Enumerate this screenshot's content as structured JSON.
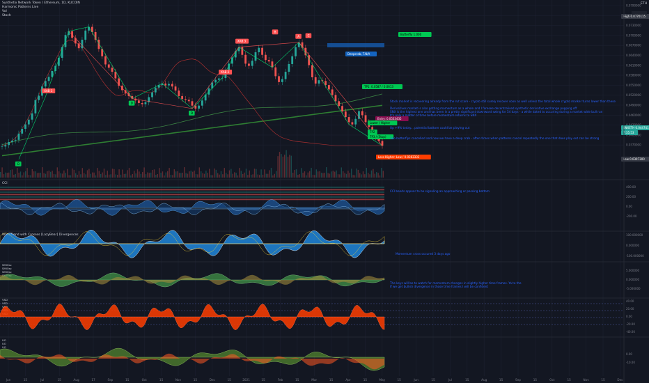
{
  "header": {
    "title": "Synthetix Network Token / Ethereum, 1D, KUCOIN",
    "line2": "Harmonic Patterns  Live",
    "line3": "Vol",
    "line4": "Stoch",
    "currency": "ETH"
  },
  "notes": [
    "Stock market is recovering already from the rut scare - crypto still surely recover soon as well unless the total whole crypto marker turns lower than these",
    "Derivatives market is also getting momentum as a whole and I foresee decentralised synthetic derivative exchange popping off",
    "SNX is the highest one and has been in a pretty significant downward swing for 54 days - a while dated to accuring during a market wide bull run",
    "It's only a matter of time before momentum returns to SNX",
    "Up +9% today... potential bottom could be playing out",
    "Two butterflys cancelled and now we have a deep crab - often times when patterns cancel repeatedly the one that does play out can be strong",
    "CCI bands appear to be signaling an approaching or passing bottom",
    "Momentum cross occured 3 days ago",
    "The keys will be to watch for momentum changes in slightly higher time frames. Ya to the",
    "If we get bullish divergence in those time frames I will be confident"
  ],
  "price_axis": [
    "0.0790000",
    "0.0760000",
    "0.0730000",
    "0.0700000",
    "0.0670000",
    "0.0640000",
    "0.0610000",
    "0.0580000",
    "0.0550000",
    "0.0520000",
    "0.0490000",
    "0.0460000",
    "0.0430000",
    "0.0400000",
    "0.0370000"
  ],
  "price_tags": {
    "high": "High",
    "high_val": "0.0770115",
    "last_sym": "SNXETH",
    "last_val": "0.0447411",
    "timer": "7:35:53",
    "low": "Low",
    "low_val": "0.0397300"
  },
  "pane_labels": {
    "cci": "CCI",
    "wave": "WaveTrend with Crosses [LazyBear]  Divergences",
    "smi": [
      "SMIOsc",
      "SMIOsc",
      "SMIOsc",
      "SMIOsc"
    ],
    "vsd": [
      "VSD",
      "VSD",
      "VSD",
      "VSD",
      "VSD"
    ],
    "uo": [
      "UO",
      "UO",
      "UO"
    ]
  },
  "pane_axes": {
    "cci": [
      "400.00",
      "200.00",
      "0.00",
      "-200.00"
    ],
    "wave": [
      "100.000000",
      "0.000000",
      "-100.000000"
    ],
    "smi": [
      "5.000000",
      "0.000000",
      "-5.000000"
    ],
    "vsd": [
      "40.00",
      "20.00",
      "0.00",
      "-20.00",
      "-40.00"
    ],
    "uo": [
      "0.00",
      "-10.00"
    ]
  },
  "time_labels": [
    "Jun",
    "15",
    "Jul",
    "15",
    "Aug",
    "17",
    "Sep",
    "15",
    "Oct",
    "15",
    "Nov",
    "15",
    "Dec",
    "15",
    "2021",
    "15",
    "Feb",
    "15",
    "Mar",
    "15",
    "Apr",
    "15",
    "May",
    "15",
    "Jun",
    "15",
    "Jul",
    "15",
    "Aug",
    "15",
    "Sep",
    "15",
    "Oct",
    "15",
    "Nov",
    "15",
    "Dec"
  ],
  "pattern_labels": {
    "x1": "XAB 1",
    "x2": "XAB 2",
    "x3": "XAB 3",
    "a": "A",
    "b": "B",
    "c": "C",
    "d1": "D",
    "d2": "D",
    "d3": "D",
    "zoom": "Butterfly  1.000",
    "target": "TP1: 0.0587 / 0.0613",
    "entry": "Entry: 0.0533435",
    "box": "Deepcrab, T.N/A",
    "loss": "Loss Higher: Low / 0.0363333",
    "green1": "Lower / Higher",
    "green2": "TP2",
    "green3": "TP3 / (Stop)"
  },
  "colors": {
    "bg": "#131722",
    "up": "#26a69a",
    "down": "#ef5350",
    "note": "#2962ff",
    "pattern_green": "#00e676",
    "pattern_red": "#ff5252",
    "vsd_red": "#ff3d00",
    "smi_green": "#4caf50"
  },
  "chart_data": {
    "type": "candlestick",
    "title": "Synthetix Network Token / Ethereum, 1D, KUCOIN",
    "ylim": [
      0.037,
      0.079
    ],
    "xrange": [
      "Jun 2020",
      "Dec 2021"
    ],
    "close": [
      0.0445,
      0.0449,
      0.0457,
      0.0461,
      0.0463,
      0.048,
      0.0493,
      0.0505,
      0.0518,
      0.0535,
      0.0571,
      0.0583,
      0.0608,
      0.0623,
      0.0634,
      0.065,
      0.0664,
      0.0686,
      0.0715,
      0.0748,
      0.0758,
      0.074,
      0.0725,
      0.0712,
      0.0735,
      0.076,
      0.077,
      0.0756,
      0.0735,
      0.071,
      0.069,
      0.0668,
      0.0659,
      0.0648,
      0.063,
      0.061,
      0.0598,
      0.059,
      0.0582,
      0.0575,
      0.057,
      0.0563,
      0.056,
      0.0565,
      0.0579,
      0.0592,
      0.0605,
      0.0612,
      0.0616,
      0.0611,
      0.0615,
      0.0608,
      0.0597,
      0.0582,
      0.0574,
      0.0572,
      0.0568,
      0.0556,
      0.0548,
      0.0556,
      0.057,
      0.0586,
      0.0603,
      0.0619,
      0.0626,
      0.063,
      0.0631,
      0.0652,
      0.067,
      0.0687,
      0.0704,
      0.0715,
      0.0694,
      0.067,
      0.0664,
      0.0678,
      0.0701,
      0.0713,
      0.0694,
      0.068,
      0.0676,
      0.066,
      0.0636,
      0.062,
      0.0628,
      0.0648,
      0.0669,
      0.069,
      0.0715,
      0.0728,
      0.0713,
      0.0693,
      0.0666,
      0.0633,
      0.0616,
      0.0625,
      0.0623,
      0.0612,
      0.06,
      0.0585,
      0.0568,
      0.0555,
      0.054,
      0.0525,
      0.0511,
      0.0505,
      0.052,
      0.0541,
      0.053,
      0.0511,
      0.0498,
      0.0483,
      0.047,
      0.046,
      0.0447
    ],
    "series": [
      {
        "name": "MA short",
        "values": [
          0.0447,
          0.045,
          0.0455,
          0.046,
          0.0468,
          0.0478,
          0.0493,
          0.0508,
          0.0525,
          0.0543,
          0.0565,
          0.0585,
          0.0607,
          0.0627,
          0.0645,
          0.0662,
          0.068,
          0.0698,
          0.0715,
          0.0728,
          0.0734,
          0.0733,
          0.0728,
          0.0722,
          0.0712,
          0.0698,
          0.0683,
          0.0668,
          0.0652,
          0.0638,
          0.0624,
          0.0612,
          0.0601,
          0.0592,
          0.0585,
          0.0583,
          0.0585,
          0.0589,
          0.0593,
          0.0596,
          0.0598,
          0.0598,
          0.0596,
          0.0593,
          0.0591,
          0.0592,
          0.0597,
          0.0604,
          0.0614,
          0.0627,
          0.0641,
          0.0655,
          0.0666,
          0.0674,
          0.0678,
          0.068,
          0.0682,
          0.0683,
          0.0681,
          0.0676,
          0.0668,
          0.0659,
          0.0651,
          0.0645,
          0.0642,
          0.0641,
          0.0641,
          0.0639,
          0.0633,
          0.0623,
          0.0612,
          0.06,
          0.0588,
          0.0576,
          0.0565,
          0.0554,
          0.0542,
          0.053,
          0.0518,
          0.0507,
          0.0497,
          0.0488,
          0.048,
          0.0474,
          0.0469,
          0.0466,
          0.0463,
          0.0461,
          0.0459,
          0.0458,
          0.0457,
          0.0456,
          0.0455,
          0.0454,
          0.0453,
          0.0452,
          0.0451,
          0.045,
          0.0449,
          0.0448,
          0.0447,
          0.0447,
          0.0447,
          0.0447,
          0.0447,
          0.0447,
          0.0447,
          0.0447,
          0.0447,
          0.0447,
          0.0447,
          0.0447,
          0.0447,
          0.0447,
          0.0447
        ]
      }
    ]
  }
}
